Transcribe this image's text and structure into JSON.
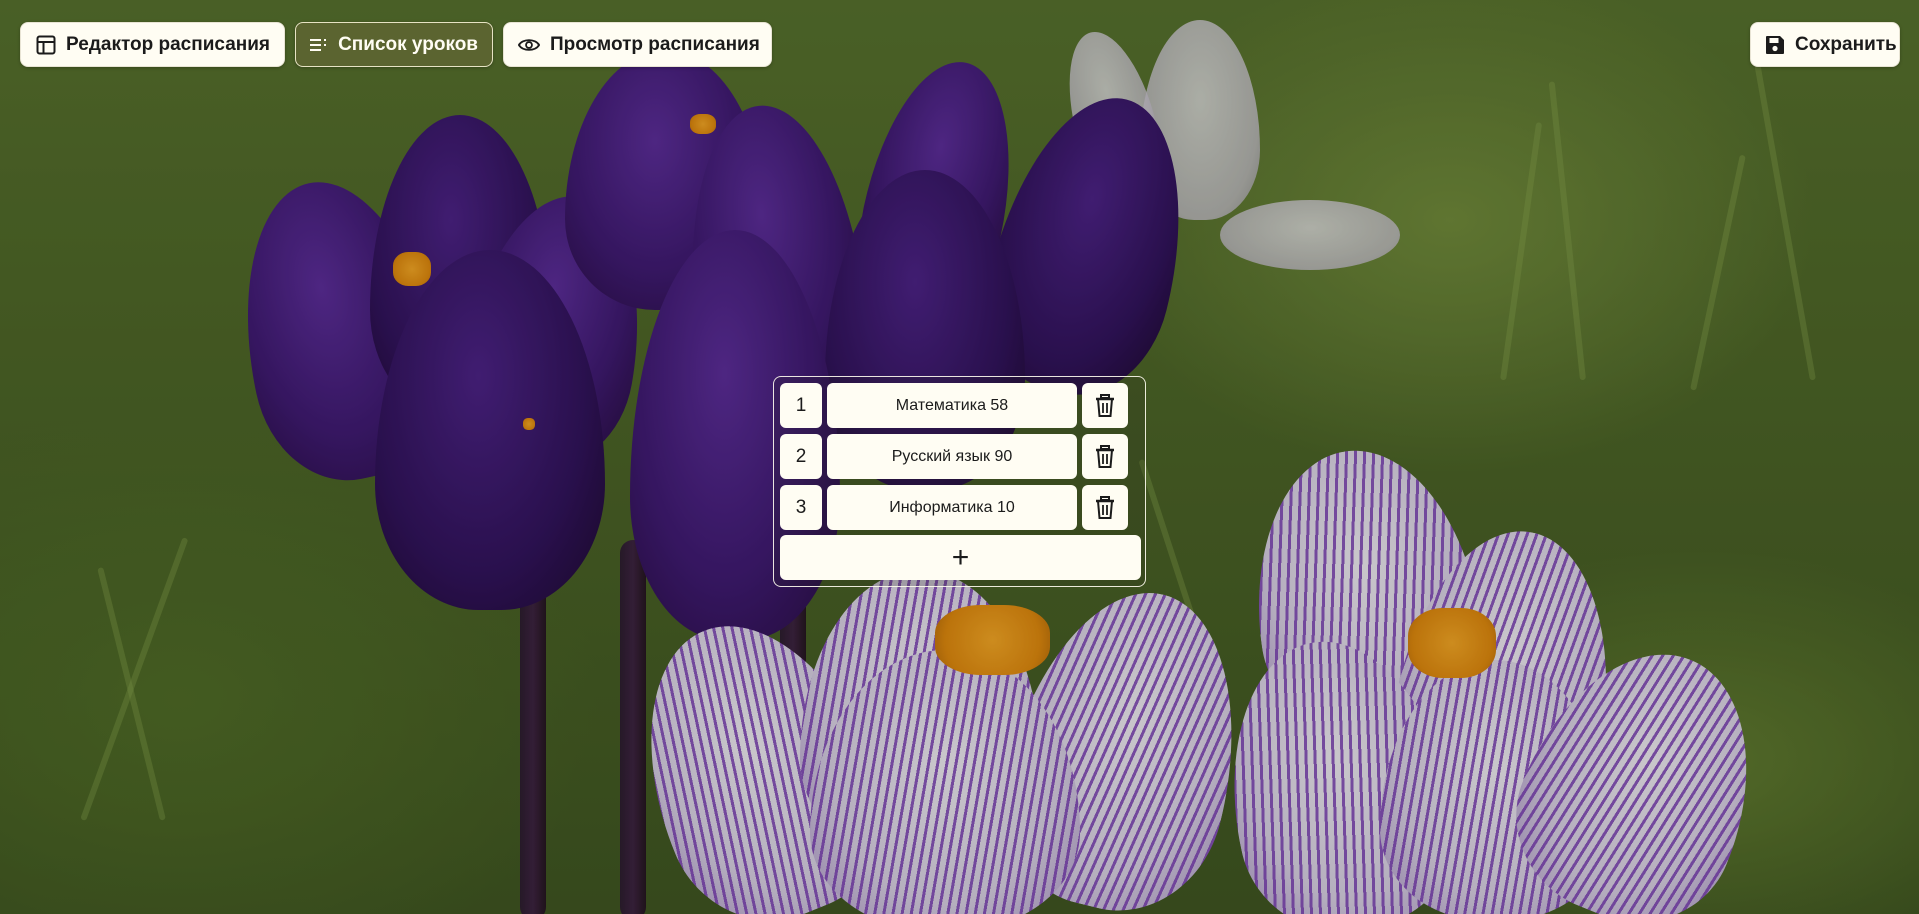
{
  "toolbar": {
    "editor_label": "Редактор расписания",
    "editor_icon": "layout-table-icon",
    "lessons_label": "Список уроков",
    "lessons_icon": "list-icon",
    "view_label": "Просмотр расписания",
    "view_icon": "eye-icon",
    "save_label": "Сохранить",
    "save_icon": "floppy-disk-icon",
    "active_tab": "lessons"
  },
  "lessons": [
    {
      "number": "1",
      "name": "Математика 58"
    },
    {
      "number": "2",
      "name": "Русский язык 90"
    },
    {
      "number": "3",
      "name": "Информатика 10"
    }
  ],
  "lesson_actions": {
    "delete_icon": "trash-icon",
    "add_symbol": "+"
  },
  "colors": {
    "button_bg": "#fffdf3",
    "active_tab_bg": "#5b6430",
    "text": "#1b1b1b"
  }
}
